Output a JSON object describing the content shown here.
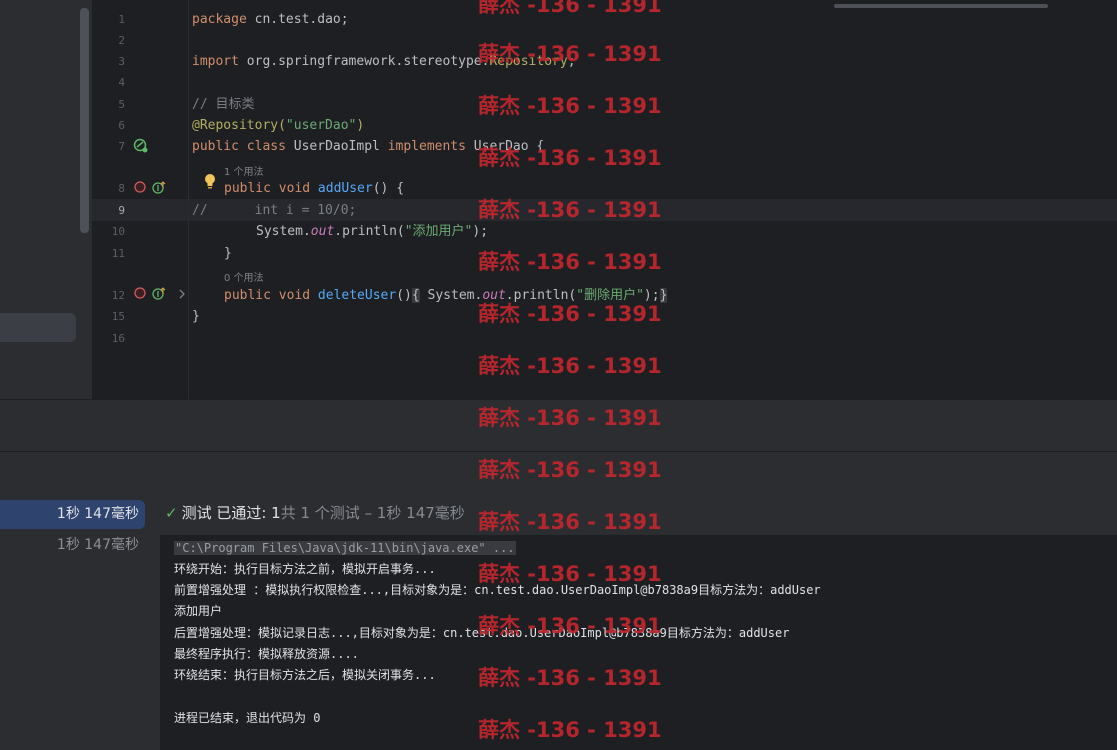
{
  "editor": {
    "line_numbers": [
      "1",
      "2",
      "3",
      "4",
      "5",
      "6",
      "7",
      "8",
      "9",
      "10",
      "11",
      "12",
      "15",
      "16"
    ],
    "lines": {
      "l1_kw": "package",
      "l1_rest": " cn.test.dao;",
      "l3_kw": "import",
      "l3_pkg": " org.springframework.stereotype.",
      "l3_cls": "Repository",
      "l3_end": ";",
      "l5_comment": "// 目标类",
      "l6_ann": "@Repository(",
      "l6_str": "\"userDao\"",
      "l6_end": ")",
      "l7_kw1": "public",
      "l7_kw2": "class",
      "l7_name": " UserDaoImpl ",
      "l7_kw3": "implements",
      "l7_end": " UserDao {",
      "hint_1": "1 个用法",
      "l8_kw": "public void",
      "l8_fn": "addUser",
      "l8_end": "() {",
      "l9_comment": "//      int i = 10/0;",
      "l10_pre": "System.",
      "l10_out": "out",
      "l10_call": ".println(",
      "l10_str": "\"添加用户\"",
      "l10_end": ");",
      "l11": "}",
      "hint_2": "0 个用法",
      "l12_kw": "public void",
      "l12_fn": "deleteUser",
      "l12_mid": "()",
      "l12_brace_open": "{",
      "l12_pre": " System.",
      "l12_out": "out",
      "l12_call": ".println(",
      "l12_str": "\"删除用户\"",
      "l12_end": ");",
      "l12_brace_close": "}",
      "l15": "}"
    }
  },
  "test_tree": {
    "items": [
      {
        "label": "1秒 147毫秒"
      },
      {
        "label": "1秒 147毫秒"
      }
    ]
  },
  "status": {
    "check_icon": "check-icon",
    "passed_label": "测试 已通过: ",
    "passed_count": "1",
    "summary": "共 1 个测试 – 1秒 147毫秒"
  },
  "console": {
    "lines": [
      "\"C:\\Program Files\\Java\\jdk-11\\bin\\java.exe\" ...",
      "环绕开始：执行目标方法之前，模拟开启事务...",
      "前置增强处理 ：模拟执行权限检查...,目标对象为是：cn.test.dao.UserDaoImpl@b7838a9目标方法为：addUser",
      "添加用户",
      "后置增强处理：模拟记录日志...,目标对象为是：cn.test.dao.UserDaoImpl@b7838a9目标方法为：addUser",
      "最终程序执行：模拟释放资源....",
      "环绕结束：执行目标方法之后，模拟关闭事务...",
      "",
      "进程已结束，退出代码为 0"
    ]
  },
  "watermark": {
    "text": "薛杰 -136 - 1391",
    "color": "#c2262d"
  },
  "colors": {
    "keyword": "#cf8e6d",
    "string": "#6aab73",
    "annotation": "#b3ae60",
    "function": "#56a8f5",
    "selection": "#2e436e",
    "pass": "#5fb865"
  }
}
